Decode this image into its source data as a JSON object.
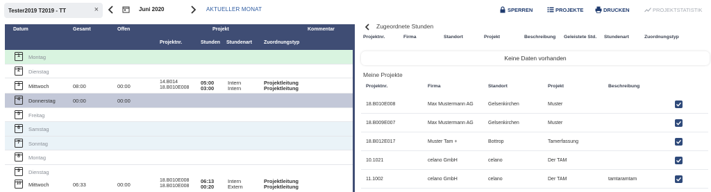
{
  "toolbar": {
    "user": "Tester2019 T2019 - TT",
    "clear": "×",
    "month": "Juni 2020",
    "current_month": "AKTUELLER MONAT",
    "lock": "SPERREN",
    "projects": "PROJEKTE",
    "print": "DRUCKEN",
    "stats": "PROJEKTSTATISTIK"
  },
  "table": {
    "headers": {
      "datum": "Datum",
      "gesamt": "Gesamt",
      "offen": "Offen",
      "projekt": "Projekt",
      "kommentar": "Kommentar",
      "projektnr": "Projektnr.",
      "stunden": "Stunden",
      "stundenart": "Stundenart",
      "zuordnungstyp": "Zuordnungstyp"
    },
    "rows": [
      {
        "num": "1",
        "day": "Montag",
        "gesamt": "",
        "offen": "",
        "p1": "",
        "p2": "",
        "h1": "",
        "h2": "",
        "a1": "",
        "a2": "",
        "z1": "",
        "z2": ""
      },
      {
        "num": "2",
        "day": "Dienstag",
        "gesamt": "",
        "offen": "",
        "p1": "",
        "p2": "",
        "h1": "",
        "h2": "",
        "a1": "",
        "a2": "",
        "z1": "",
        "z2": ""
      },
      {
        "num": "3",
        "day": "Mittwoch",
        "gesamt": "08:00",
        "offen": "00:00",
        "p1": "14.B014",
        "p2": "18.B010E008",
        "h1": "05:00",
        "h2": "03:00",
        "a1": "Intern",
        "a2": "Intern",
        "z1": "Projektleitung",
        "z2": "Projektleitung"
      },
      {
        "num": "4",
        "day": "Donnerstag",
        "gesamt": "00:00",
        "offen": "00:00",
        "p1": "",
        "p2": "",
        "h1": "",
        "h2": "",
        "a1": "",
        "a2": "",
        "z1": "",
        "z2": ""
      },
      {
        "num": "5",
        "day": "Freitag",
        "gesamt": "",
        "offen": "",
        "p1": "",
        "p2": "",
        "h1": "",
        "h2": "",
        "a1": "",
        "a2": "",
        "z1": "",
        "z2": ""
      },
      {
        "num": "6",
        "day": "Samstag",
        "gesamt": "",
        "offen": "",
        "p1": "",
        "p2": "",
        "h1": "",
        "h2": "",
        "a1": "",
        "a2": "",
        "z1": "",
        "z2": ""
      },
      {
        "num": "7",
        "day": "Sonntag",
        "gesamt": "",
        "offen": "",
        "p1": "",
        "p2": "",
        "h1": "",
        "h2": "",
        "a1": "",
        "a2": "",
        "z1": "",
        "z2": ""
      },
      {
        "num": "8",
        "day": "Montag",
        "gesamt": "",
        "offen": "",
        "p1": "",
        "p2": "",
        "h1": "",
        "h2": "",
        "a1": "",
        "a2": "",
        "z1": "",
        "z2": ""
      },
      {
        "num": "9",
        "day": "Dienstag",
        "gesamt": "",
        "offen": "",
        "p1": "",
        "p2": "",
        "h1": "",
        "h2": "",
        "a1": "",
        "a2": "",
        "z1": "",
        "z2": ""
      },
      {
        "num": "10",
        "day": "Mittwoch",
        "gesamt": "06:33",
        "offen": "00:00",
        "p1": "18.B010E008",
        "p2": "18.B010E008",
        "h1": "06:13",
        "h2": "00:20",
        "a1": "Intern",
        "a2": "Extern",
        "z1": "Projektleitung",
        "z2": "Projektleitung"
      }
    ]
  },
  "assigned": {
    "title": "Zugeordnete Stunden",
    "headers": {
      "projektnr": "Projektnr.",
      "firma": "Firma",
      "standort": "Standort",
      "projekt": "Projekt",
      "beschreibung": "Beschreibung",
      "geleistete": "Geleistete Std.",
      "stundenart": "Stundenart",
      "zuordnungstyp": "Zuordnungstyp"
    },
    "empty": "Keine Daten vorhanden"
  },
  "my_projects": {
    "title": "Meine Projekte",
    "headers": {
      "projektnr": "Projektnr.",
      "firma": "Firma",
      "standort": "Standort",
      "projekt": "Projekt",
      "beschreibung": "Beschreibung"
    },
    "rows": [
      {
        "nr": "18.B010E008",
        "firma": "Max Mustermann AG",
        "standort": "Gelsenkirchen",
        "projekt": "Muster",
        "beschreibung": ""
      },
      {
        "nr": "18.B009E007",
        "firma": "Max Mustermann AG",
        "standort": "Gelsenkirchen",
        "projekt": "Muster",
        "beschreibung": ""
      },
      {
        "nr": "18.B012E017",
        "firma": "Muster Tam +",
        "standort": "Bottrop",
        "projekt": "Tamerfassung",
        "beschreibung": ""
      },
      {
        "nr": "10.1021",
        "firma": "celano GmbH",
        "standort": "celano",
        "projekt": "Der TAM",
        "beschreibung": ""
      },
      {
        "nr": "11.1002",
        "firma": "celano GmbH",
        "standort": "celano",
        "projekt": "Der TAM",
        "beschreibung": "tamtaramtam"
      }
    ]
  },
  "colors": {
    "header": "#3f4d74",
    "green_row": "#d9f4e0",
    "blue_row": "#eaf3f8",
    "selected_row": "#c3c8d8",
    "link": "#2c5aa0",
    "checkbox": "#2f4a7a"
  }
}
